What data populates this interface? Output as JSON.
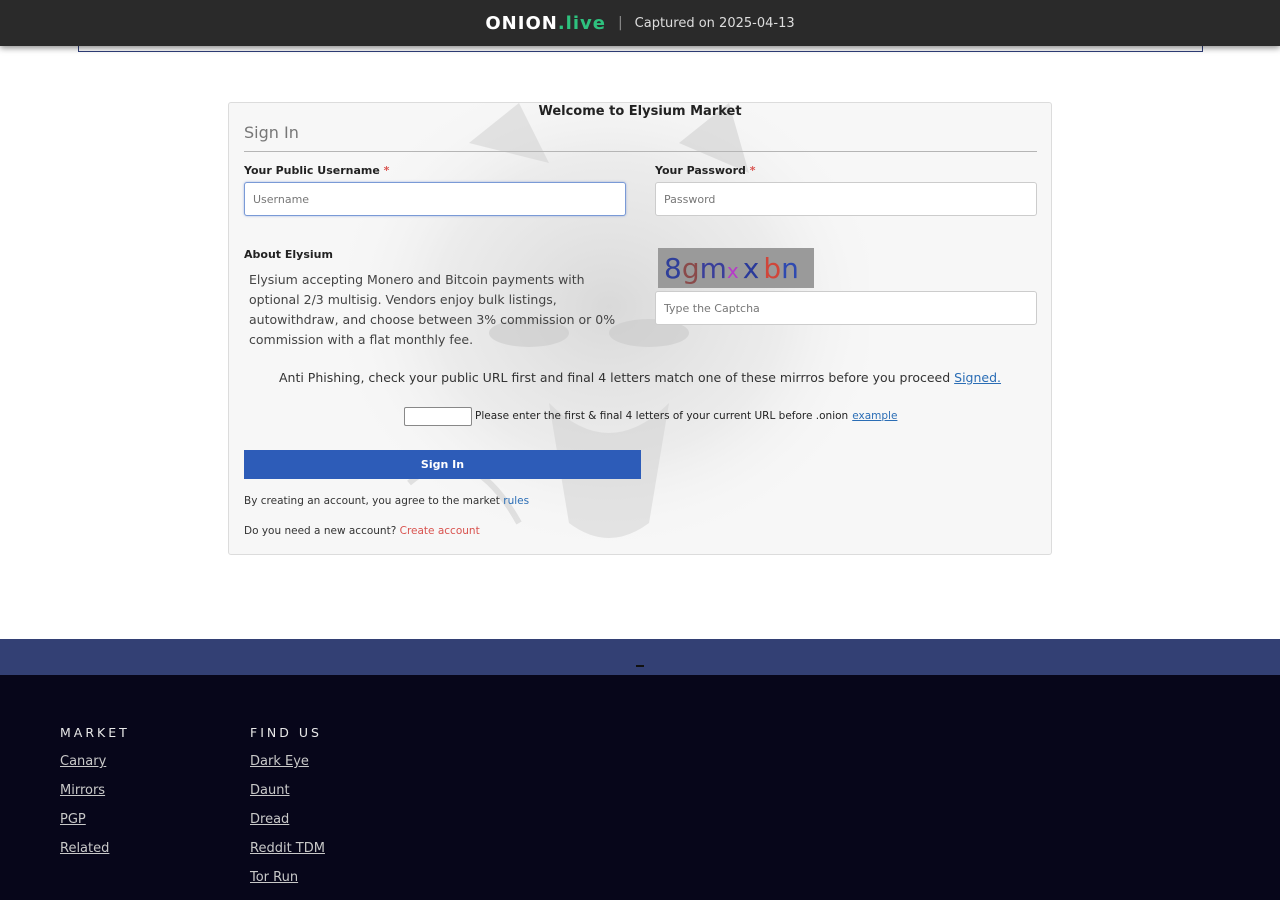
{
  "capture_bar": {
    "brand_main": "ONION",
    "brand_tld": ".live",
    "separator": "|",
    "captured_text": "Captured on 2025-04-13"
  },
  "card": {
    "welcome": "Welcome to Elysium Market",
    "title": "Sign In",
    "username": {
      "label": "Your Public Username",
      "required_mark": "*",
      "placeholder": "Username",
      "value": ""
    },
    "password": {
      "label": "Your Password",
      "required_mark": "*",
      "placeholder": "Password",
      "value": ""
    },
    "about": {
      "label": "About Elysium",
      "text": "Elysium accepting Monero and Bitcoin payments with optional 2/3 multisig. Vendors enjoy bulk listings, autowithdraw, and choose between 3% commission or 0% commission with a flat monthly fee."
    },
    "captcha": {
      "characters": [
        "8",
        "g",
        "m",
        "x",
        "x",
        "b",
        "n"
      ],
      "colors": [
        "#2f3f9a",
        "#8a4a4a",
        "#3a3f9a",
        "#b63ac9",
        "#2a3a9a",
        "#d0463a",
        "#2f4ab0"
      ],
      "placeholder": "Type the Captcha"
    },
    "anti_phishing": {
      "text": "Anti Phishing, check your public URL first and final 4 letters match one of these mirrros before you proceed",
      "link": "Signed."
    },
    "verify": {
      "text": "Please enter the first & final 4 letters of your current URL before .onion",
      "link": "example"
    },
    "submit_label": "Sign In",
    "terms": {
      "text": "By creating an account, you agree to the market",
      "link": "rules"
    },
    "register": {
      "text": "Do you need a new account?",
      "link": "Create account"
    }
  },
  "footer": {
    "strip_mark": "–",
    "columns": [
      {
        "heading": "MARKET",
        "links": [
          "Canary",
          "Mirrors",
          "PGP",
          "Related"
        ]
      },
      {
        "heading": "FIND US",
        "links": [
          "Dark Eye",
          "Daunt",
          "Dread",
          "Reddit TDM",
          "Tor Run"
        ]
      }
    ]
  },
  "colors": {
    "topbar_bg": "#2a2a2a",
    "brand_accent": "#2ec27e",
    "button_bg": "#2d5cb8",
    "required": "#d9534f",
    "link": "#2a6db5",
    "footer_strip": "#334074",
    "footer_bg": "#07061a"
  }
}
